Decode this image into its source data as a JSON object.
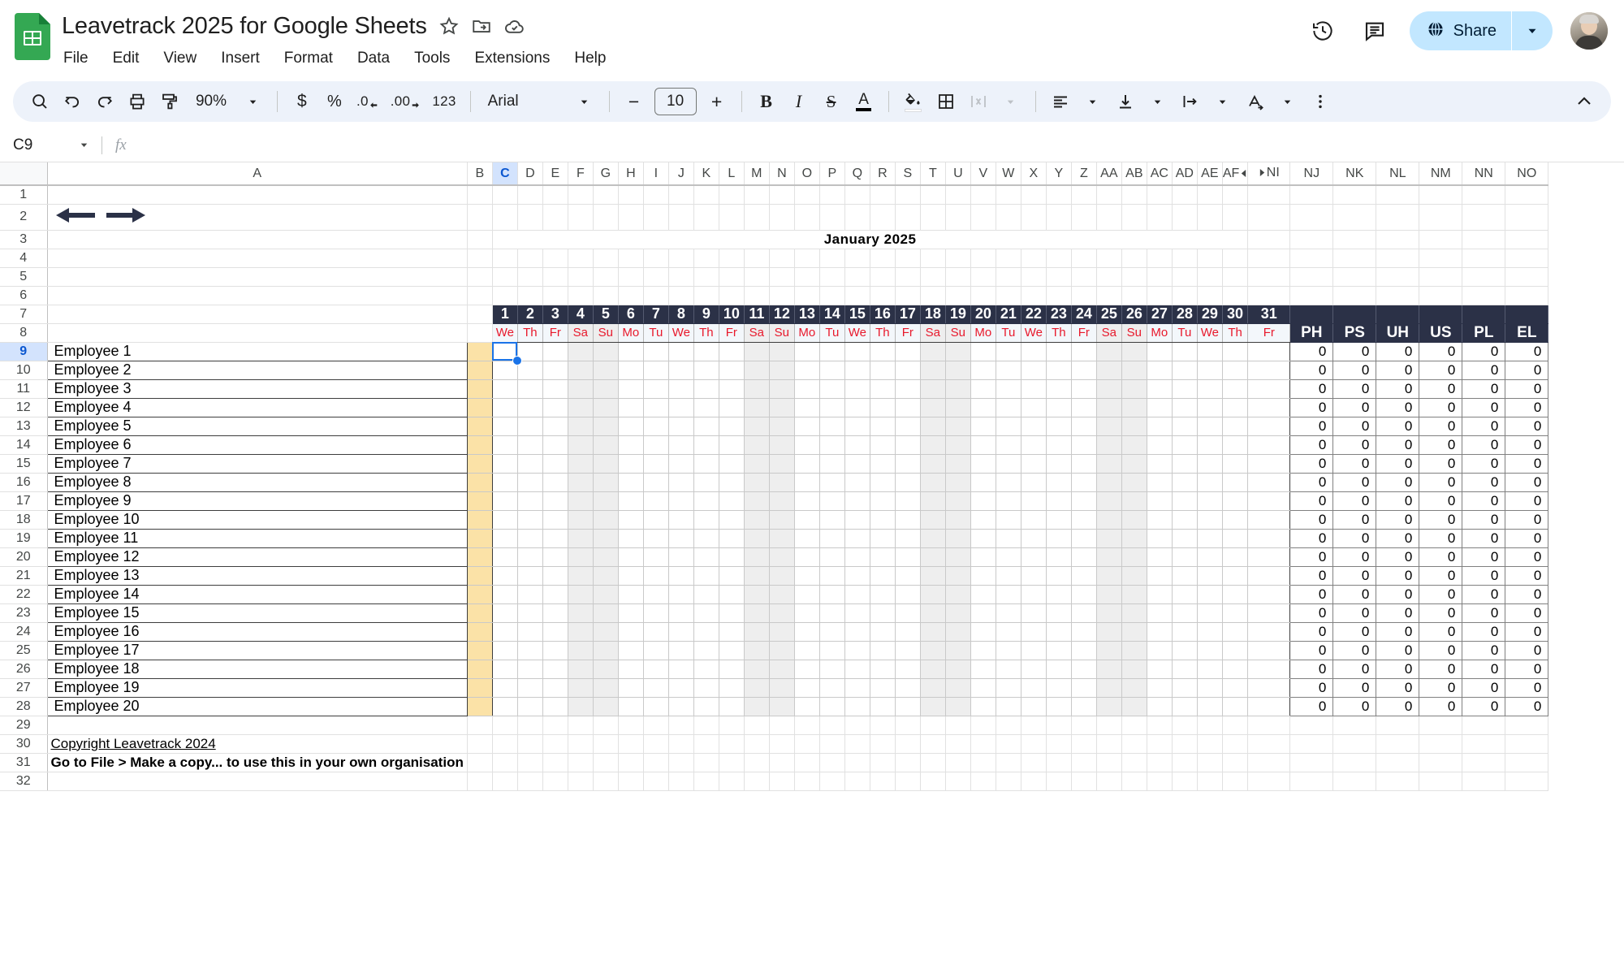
{
  "header": {
    "doc_title": "Leavetrack 2025 for Google Sheets",
    "star_icon": "star-icon",
    "move_icon": "move-to-folder-icon",
    "cloud_icon": "cloud-saved-icon",
    "menus": [
      "File",
      "Edit",
      "View",
      "Insert",
      "Format",
      "Data",
      "Tools",
      "Extensions",
      "Help"
    ],
    "history_icon": "version-history-icon",
    "comment_icon": "comment-icon",
    "share_label": "Share",
    "share_globe_icon": "globe-icon",
    "share_caret_icon": "chevron-down-icon",
    "avatar_name": "account-avatar"
  },
  "toolbar": {
    "search_icon": "search-icon",
    "undo_icon": "undo-icon",
    "redo_icon": "redo-icon",
    "print_icon": "print-icon",
    "paint_icon": "paint-format-icon",
    "zoom_value": "90%",
    "zoom_caret": "chevron-down-icon",
    "currency_label": "$",
    "percent_label": "%",
    "decrease_decimal_label": ".0",
    "increase_decimal_label": ".00",
    "more_formats_label": "123",
    "font_family": "Arial",
    "font_caret": "chevron-down-icon",
    "font_decrease": "−",
    "font_size": "10",
    "font_increase": "+",
    "bold_label": "B",
    "italic_label": "I",
    "strikethrough_label": "S",
    "text_color_label": "A",
    "fill_color_icon": "fill-color-icon",
    "borders_icon": "borders-icon",
    "merge_icon": "merge-cells-icon",
    "merge_caret": "chevron-down-icon",
    "halign_icon": "horizontal-align-icon",
    "halign_caret": "chevron-down-icon",
    "valign_icon": "vertical-align-icon",
    "valign_caret": "chevron-down-icon",
    "wrap_icon": "text-wrapping-icon",
    "wrap_caret": "chevron-down-icon",
    "rotate_icon": "text-rotation-icon",
    "rotate_caret": "chevron-down-icon",
    "more_icon": "more-options-icon",
    "collapse_icon": "collapse-toolbar-icon"
  },
  "formula_bar": {
    "name_box_value": "C9",
    "name_box_caret": "chevron-down-icon",
    "fx_label": "fx",
    "formula_value": "",
    "formula_placeholder": ""
  },
  "grid": {
    "columns": [
      "A",
      "B",
      "C",
      "D",
      "E",
      "F",
      "G",
      "H",
      "I",
      "J",
      "K",
      "L",
      "M",
      "N",
      "O",
      "P",
      "Q",
      "R",
      "S",
      "T",
      "U",
      "V",
      "W",
      "X",
      "Y",
      "Z",
      "AA",
      "AB",
      "AC",
      "AD",
      "AE",
      "AF",
      "NI",
      "NJ",
      "NK",
      "NL",
      "NM",
      "NN",
      "NO"
    ],
    "selected_column": "C",
    "hidden_col_indicator": "hidden-columns-indicator",
    "rows": [
      "1",
      "2",
      "3",
      "4",
      "5",
      "6",
      "7",
      "8",
      "9",
      "10",
      "11",
      "12",
      "13",
      "14",
      "15",
      "16",
      "17",
      "18",
      "19",
      "20",
      "21",
      "22",
      "23",
      "24",
      "25",
      "26",
      "27",
      "28",
      "29",
      "30",
      "31",
      "32"
    ],
    "selected_row": "9",
    "selected_cell": "C9"
  },
  "sheet": {
    "title": "January 2025",
    "nav_prev_icon": "previous-month-arrow",
    "nav_next_icon": "next-month-arrow",
    "days": [
      1,
      2,
      3,
      4,
      5,
      6,
      7,
      8,
      9,
      10,
      11,
      12,
      13,
      14,
      15,
      16,
      17,
      18,
      19,
      20,
      21,
      22,
      23,
      24,
      25,
      26,
      27,
      28,
      29,
      30,
      31
    ],
    "dows": [
      "We",
      "Th",
      "Fr",
      "Sa",
      "Su",
      "Mo",
      "Tu",
      "We",
      "Th",
      "Fr",
      "Sa",
      "Su",
      "Mo",
      "Tu",
      "We",
      "Th",
      "Fr",
      "Sa",
      "Su",
      "Mo",
      "Tu",
      "We",
      "Th",
      "Fr",
      "Sa",
      "Su",
      "Mo",
      "Tu",
      "We",
      "Th",
      "Fr"
    ],
    "weekend_days": [
      4,
      5,
      11,
      12,
      18,
      19,
      25,
      26
    ],
    "employees": [
      "Employee 1",
      "Employee 2",
      "Employee 3",
      "Employee 4",
      "Employee 5",
      "Employee 6",
      "Employee 7",
      "Employee 8",
      "Employee 9",
      "Employee 10",
      "Employee 11",
      "Employee 12",
      "Employee 13",
      "Employee 14",
      "Employee 15",
      "Employee 16",
      "Employee 17",
      "Employee 18",
      "Employee 19",
      "Employee 20"
    ],
    "summary_headers": [
      "PH",
      "PS",
      "UH",
      "US",
      "PL",
      "EL"
    ],
    "summary_values": [
      [
        0,
        0,
        0,
        0,
        0,
        0
      ],
      [
        0,
        0,
        0,
        0,
        0,
        0
      ],
      [
        0,
        0,
        0,
        0,
        0,
        0
      ],
      [
        0,
        0,
        0,
        0,
        0,
        0
      ],
      [
        0,
        0,
        0,
        0,
        0,
        0
      ],
      [
        0,
        0,
        0,
        0,
        0,
        0
      ],
      [
        0,
        0,
        0,
        0,
        0,
        0
      ],
      [
        0,
        0,
        0,
        0,
        0,
        0
      ],
      [
        0,
        0,
        0,
        0,
        0,
        0
      ],
      [
        0,
        0,
        0,
        0,
        0,
        0
      ],
      [
        0,
        0,
        0,
        0,
        0,
        0
      ],
      [
        0,
        0,
        0,
        0,
        0,
        0
      ],
      [
        0,
        0,
        0,
        0,
        0,
        0
      ],
      [
        0,
        0,
        0,
        0,
        0,
        0
      ],
      [
        0,
        0,
        0,
        0,
        0,
        0
      ],
      [
        0,
        0,
        0,
        0,
        0,
        0
      ],
      [
        0,
        0,
        0,
        0,
        0,
        0
      ],
      [
        0,
        0,
        0,
        0,
        0,
        0
      ],
      [
        0,
        0,
        0,
        0,
        0,
        0
      ],
      [
        0,
        0,
        0,
        0,
        0,
        0
      ]
    ],
    "copyright_link": "Copyright Leavetrack 2024",
    "notice_text": "Go to File > Make a copy... to use this in your own organisation"
  },
  "colors": {
    "header_navy": "#2b3147",
    "title_red": "#dc3545",
    "dow_red": "#e8192c",
    "col_b_tan": "#fbe2a7",
    "weekend_gray": "#eeeeee",
    "selection_blue": "#1a73e8",
    "share_blue": "#c2e7ff",
    "link_blue": "#1155cc"
  }
}
